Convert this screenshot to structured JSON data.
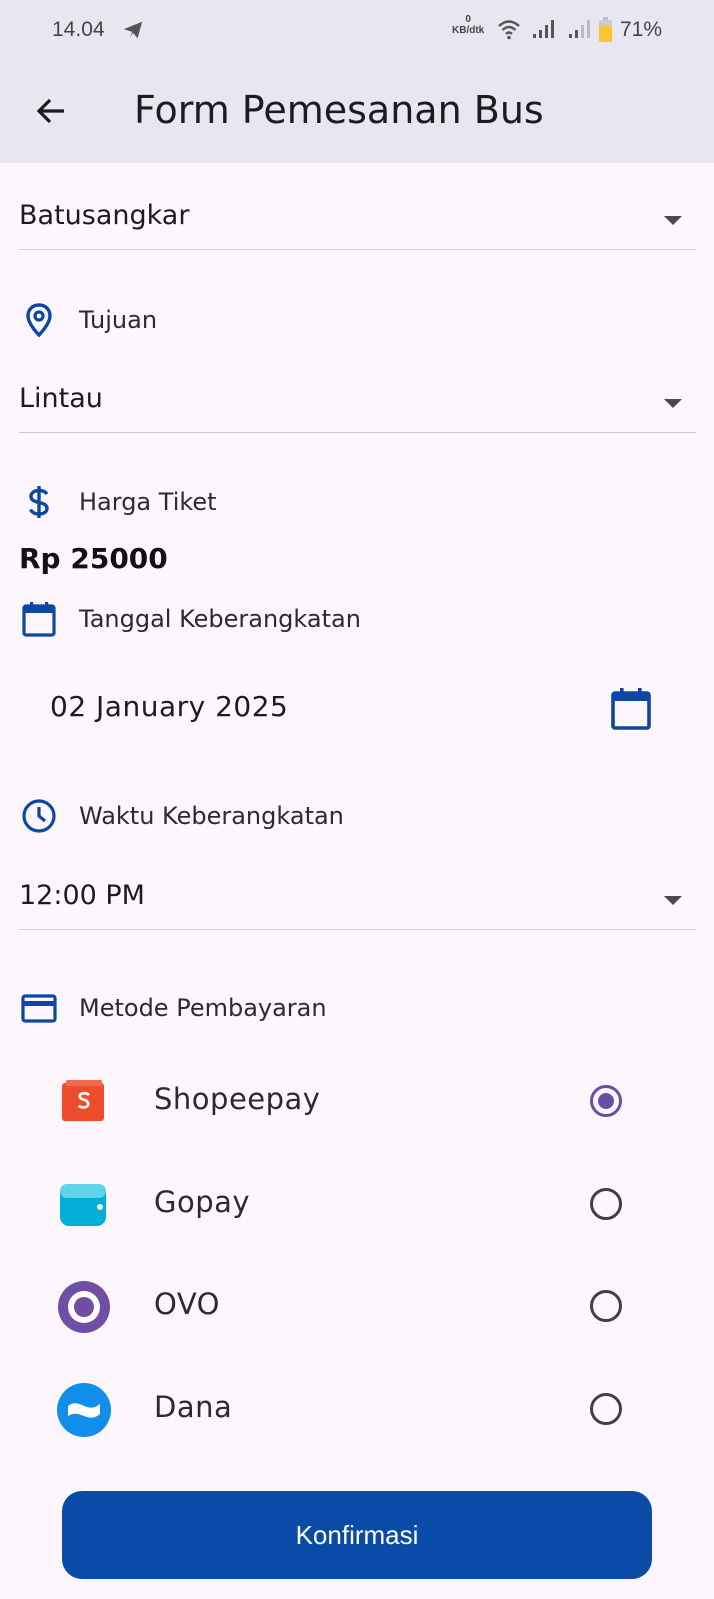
{
  "status_bar": {
    "time": "14.04",
    "net_speed_value": "0",
    "net_speed_unit": "KB/dtk",
    "battery": "71%"
  },
  "app_bar": {
    "title": "Form Pemesanan Bus",
    "back_icon": "arrow-back-icon"
  },
  "form": {
    "origin": {
      "value": "Batusangkar"
    },
    "destination": {
      "label": "Tujuan",
      "icon": "location-pin-icon",
      "value": "Lintau"
    },
    "price": {
      "label": "Harga Tiket",
      "icon": "dollar-icon",
      "value": "Rp 25000"
    },
    "date": {
      "label": "Tanggal Keberangkatan",
      "icon": "calendar-icon",
      "value": "02 January 2025"
    },
    "time": {
      "label": "Waktu Keberangkatan",
      "icon": "clock-icon",
      "value": "12:00 PM"
    },
    "payment": {
      "label": "Metode Pembayaran",
      "icon": "credit-card-icon",
      "selected": "Shopeepay",
      "options": [
        {
          "name": "Shopeepay",
          "icon": "shopeepay-logo",
          "color": "#ee4d2d"
        },
        {
          "name": "Gopay",
          "icon": "gopay-logo",
          "color": "#00aed6"
        },
        {
          "name": "OVO",
          "icon": "ovo-logo",
          "color": "#6f4fa5"
        },
        {
          "name": "Dana",
          "icon": "dana-logo",
          "color": "#118ee9"
        }
      ]
    }
  },
  "confirm_button": {
    "label": "Konfirmasi"
  },
  "colors": {
    "primary": "#0a4ba8",
    "icon_blue": "#0d47a1",
    "radio_selected": "#6650a4",
    "app_bar_bg": "#e8e6f0",
    "page_bg": "#fdf7fd"
  }
}
